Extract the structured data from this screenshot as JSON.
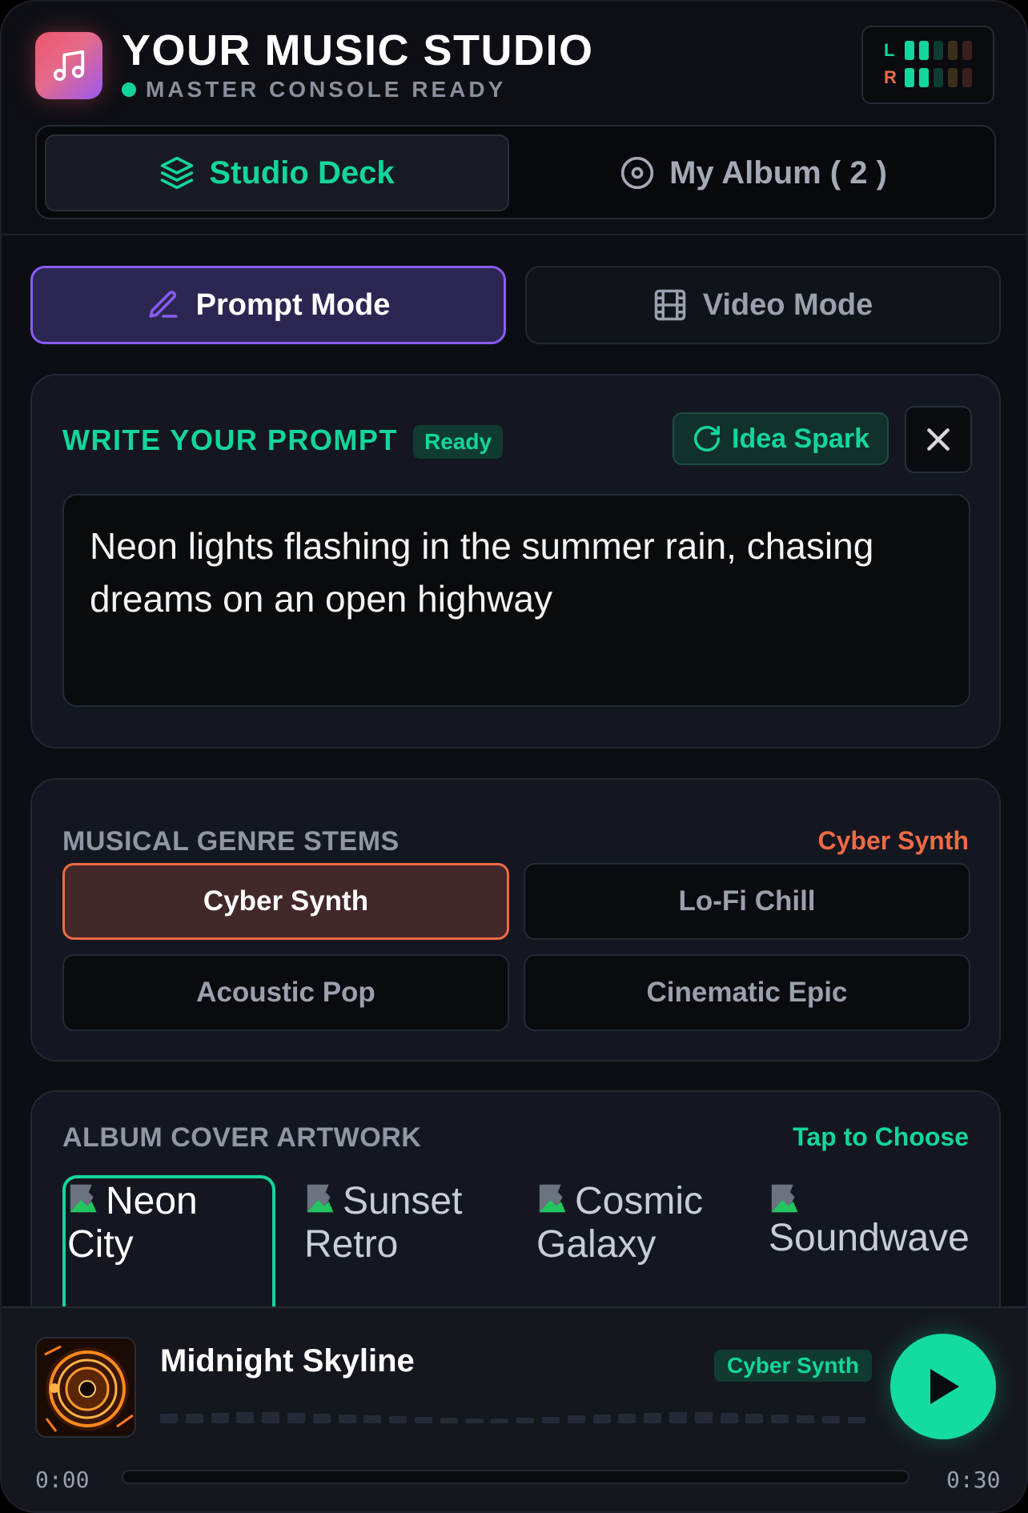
{
  "header": {
    "title": "YOUR MUSIC STUDIO",
    "status": "MASTER CONSOLE READY",
    "meter": {
      "left_label": "L",
      "right_label": "R"
    }
  },
  "top_tabs": {
    "studio_deck": "Studio Deck",
    "my_album": "My Album ( 2 )"
  },
  "mode_tabs": {
    "prompt": "Prompt Mode",
    "video": "Video Mode"
  },
  "prompt_card": {
    "label": "WRITE YOUR PROMPT",
    "badge": "Ready",
    "spark_label": "Idea Spark",
    "text": "Neon lights flashing in the summer rain, chasing dreams on an open highway"
  },
  "genre_card": {
    "label": "MUSICAL GENRE STEMS",
    "selected": "Cyber Synth",
    "options": [
      "Cyber Synth",
      "Lo-Fi Chill",
      "Acoustic Pop",
      "Cinematic Epic"
    ]
  },
  "album_card": {
    "label": "ALBUM COVER ARTWORK",
    "hint": "Tap to Choose",
    "covers": [
      "Neon City",
      "Sunset Retro",
      "Cosmic Galaxy",
      "Soundwave"
    ]
  },
  "player": {
    "track_title": "Midnight Skyline",
    "genre_tag": "Cyber Synth",
    "time_current": "0:00",
    "time_total": "0:30",
    "progress": 0
  },
  "colors": {
    "accent_green": "#13d69c",
    "accent_purple": "#8b5cf6",
    "accent_orange": "#ef6a47",
    "background": "#0d0e13"
  },
  "icons": {
    "app": "music-note-icon",
    "studio_deck": "layers-icon",
    "my_album": "disc-icon",
    "prompt_mode": "pencil-icon",
    "video_mode": "film-icon",
    "idea_spark": "refresh-icon",
    "close": "close-icon",
    "play": "play-icon"
  }
}
